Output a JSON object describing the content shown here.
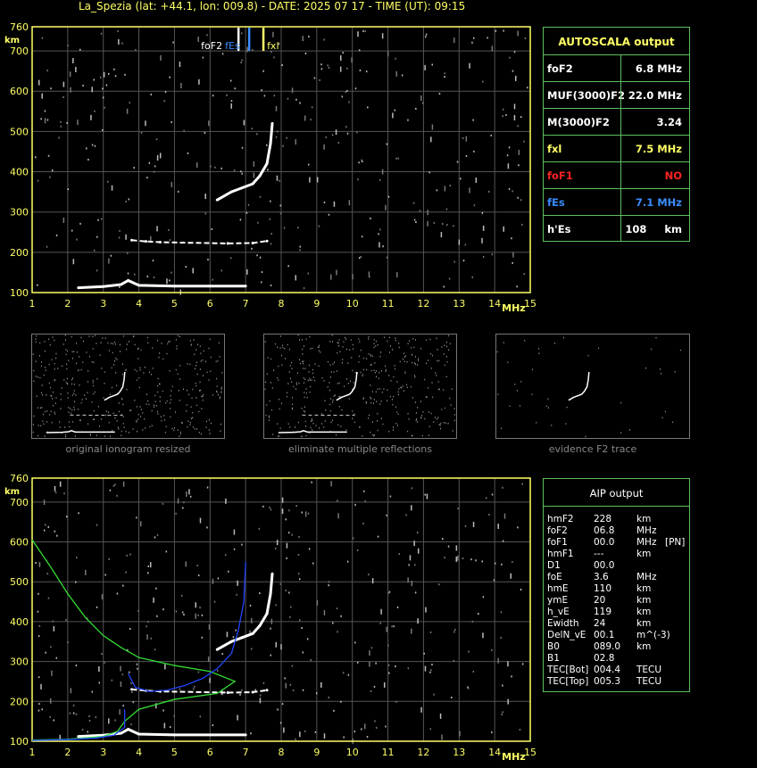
{
  "header": {
    "title": "La_Spezia (lat: +44.1, lon: 009.8) - DATE: 2025 07 17 - TIME (UT): 09:15"
  },
  "ionogram_top": {
    "ylabel": "km",
    "xlabel": "MHz",
    "yticks": [
      "100",
      "200",
      "300",
      "400",
      "500",
      "600",
      "700",
      "760"
    ],
    "xticks": [
      "1",
      "2",
      "3",
      "4",
      "5",
      "6",
      "7",
      "8",
      "9",
      "10",
      "11",
      "12",
      "13",
      "14",
      "15"
    ],
    "markers": {
      "foF2": "foF2",
      "fxl": "fxl",
      "fEs": "fEs"
    }
  },
  "chart_data": [
    {
      "type": "scatter",
      "title": "",
      "xlabel": "MHz",
      "ylabel": "km",
      "xlim": [
        1,
        15
      ],
      "ylim": [
        100,
        760
      ],
      "grid": true,
      "series": [
        {
          "values": [
            [
              2.3,
              112
            ],
            [
              3.0,
              115
            ],
            [
              3.5,
              120
            ],
            [
              3.7,
              130
            ],
            [
              4.0,
              118
            ],
            [
              5.0,
              116
            ],
            [
              6.0,
              116
            ],
            [
              7.0,
              116
            ]
          ]
        },
        {
          "values": [
            [
              6.2,
              330
            ],
            [
              6.6,
              350
            ],
            [
              6.9,
              360
            ],
            [
              7.2,
              370
            ],
            [
              7.4,
              390
            ],
            [
              7.6,
              420
            ],
            [
              7.7,
              470
            ],
            [
              7.75,
              520
            ]
          ]
        },
        {
          "values": [
            [
              3.8,
              230
            ],
            [
              4.2,
              227
            ],
            [
              4.6,
              225
            ],
            [
              6.5,
              222
            ],
            [
              7.2,
              223
            ],
            [
              7.6,
              228
            ]
          ]
        }
      ],
      "vertical_markers": [
        {
          "name": "foF2",
          "x": 6.8,
          "color": "#ffffff"
        },
        {
          "name": "fEs",
          "x": 7.1,
          "color": "#3a8dff"
        },
        {
          "name": "fxl",
          "x": 7.5,
          "color": "#ffff66"
        }
      ]
    },
    {
      "type": "line",
      "title": "",
      "xlabel": "MHz",
      "ylabel": "km",
      "xlim": [
        1,
        15
      ],
      "ylim": [
        100,
        760
      ],
      "grid": true,
      "series": [
        {
          "color": "#33dd33",
          "values": [
            [
              1.0,
              605
            ],
            [
              1.5,
              540
            ],
            [
              2.0,
              470
            ],
            [
              2.5,
              410
            ],
            [
              3.0,
              365
            ],
            [
              3.5,
              335
            ],
            [
              4.0,
              310
            ],
            [
              5.0,
              290
            ],
            [
              6.0,
              275
            ],
            [
              6.7,
              250
            ],
            [
              6.2,
              220
            ],
            [
              5.0,
              205
            ],
            [
              4.0,
              180
            ],
            [
              3.6,
              150
            ],
            [
              3.4,
              125
            ],
            [
              3.0,
              112
            ],
            [
              2.0,
              105
            ],
            [
              1.0,
              103
            ]
          ]
        },
        {
          "color": "#2244ff",
          "values": [
            [
              3.7,
              270
            ],
            [
              3.9,
              235
            ],
            [
              4.3,
              225
            ],
            [
              4.8,
              228
            ],
            [
              5.3,
              240
            ],
            [
              5.8,
              258
            ],
            [
              6.2,
              282
            ],
            [
              6.6,
              320
            ],
            [
              6.8,
              380
            ],
            [
              6.95,
              450
            ],
            [
              7.0,
              550
            ]
          ]
        },
        {
          "color": "#2244ff",
          "values": [
            [
              1.0,
              102
            ],
            [
              2.0,
              104
            ],
            [
              2.8,
              108
            ],
            [
              3.3,
              115
            ],
            [
              3.6,
              135
            ],
            [
              3.6,
              180
            ]
          ]
        }
      ]
    }
  ],
  "autoscala": {
    "title": "AUTOSCALA output",
    "rows": [
      {
        "key": "foF2",
        "value": "6.8 MHz",
        "key_color": "#ffffff",
        "value_color": "#ffffff"
      },
      {
        "key": "MUF(3000)F2",
        "value": "22.0 MHz",
        "key_color": "#ffffff",
        "value_color": "#ffffff"
      },
      {
        "key": "M(3000)F2",
        "value": "3.24",
        "key_color": "#ffffff",
        "value_color": "#ffffff"
      },
      {
        "key": "fxl",
        "value": "7.5 MHz",
        "key_color": "#ffff66",
        "value_color": "#ffff66"
      },
      {
        "key": "foF1",
        "value": "NO",
        "key_color": "#ff2222",
        "value_color": "#ff2222"
      },
      {
        "key": "fEs",
        "value": "7.1 MHz",
        "key_color": "#3a8dff",
        "value_color": "#3a8dff"
      },
      {
        "key": "h'Es",
        "value": "108     km",
        "key_color": "#ffffff",
        "value_color": "#ffffff"
      }
    ]
  },
  "thumbnails": [
    {
      "caption": "original ionogram resized"
    },
    {
      "caption": "eliminate multiple reflections"
    },
    {
      "caption": "evidence F2 trace"
    }
  ],
  "aip": {
    "title": "AIP output",
    "rows": [
      {
        "name": "hmF2",
        "value": "228",
        "unit": "km",
        "note": ""
      },
      {
        "name": "foF2",
        "value": "06.8",
        "unit": "MHz",
        "note": ""
      },
      {
        "name": "foF1",
        "value": "00.0",
        "unit": "MHz",
        "note": "[PN]"
      },
      {
        "name": "hmF1",
        "value": "---",
        "unit": "km",
        "note": ""
      },
      {
        "name": "D1",
        "value": "00.0",
        "unit": "",
        "note": ""
      },
      {
        "name": "foE",
        "value": "3.6",
        "unit": "MHz",
        "note": ""
      },
      {
        "name": "hmE",
        "value": "110",
        "unit": "km",
        "note": ""
      },
      {
        "name": "ymE",
        "value": "20",
        "unit": "km",
        "note": ""
      },
      {
        "name": "h_vE",
        "value": "119",
        "unit": "km",
        "note": ""
      },
      {
        "name": "Ewidth",
        "value": "24",
        "unit": "km",
        "note": ""
      },
      {
        "name": "DelN_vE",
        "value": "00.1",
        "unit": "m^(-3)",
        "note": ""
      },
      {
        "name": "B0",
        "value": "089.0",
        "unit": "km",
        "note": ""
      },
      {
        "name": "B1",
        "value": "02.8",
        "unit": "",
        "note": ""
      },
      {
        "name": "TEC[Bot]",
        "value": "004.4",
        "unit": "TECU",
        "note": ""
      },
      {
        "name": "TEC[Top]",
        "value": "005.3",
        "unit": "TECU",
        "note": ""
      }
    ]
  }
}
